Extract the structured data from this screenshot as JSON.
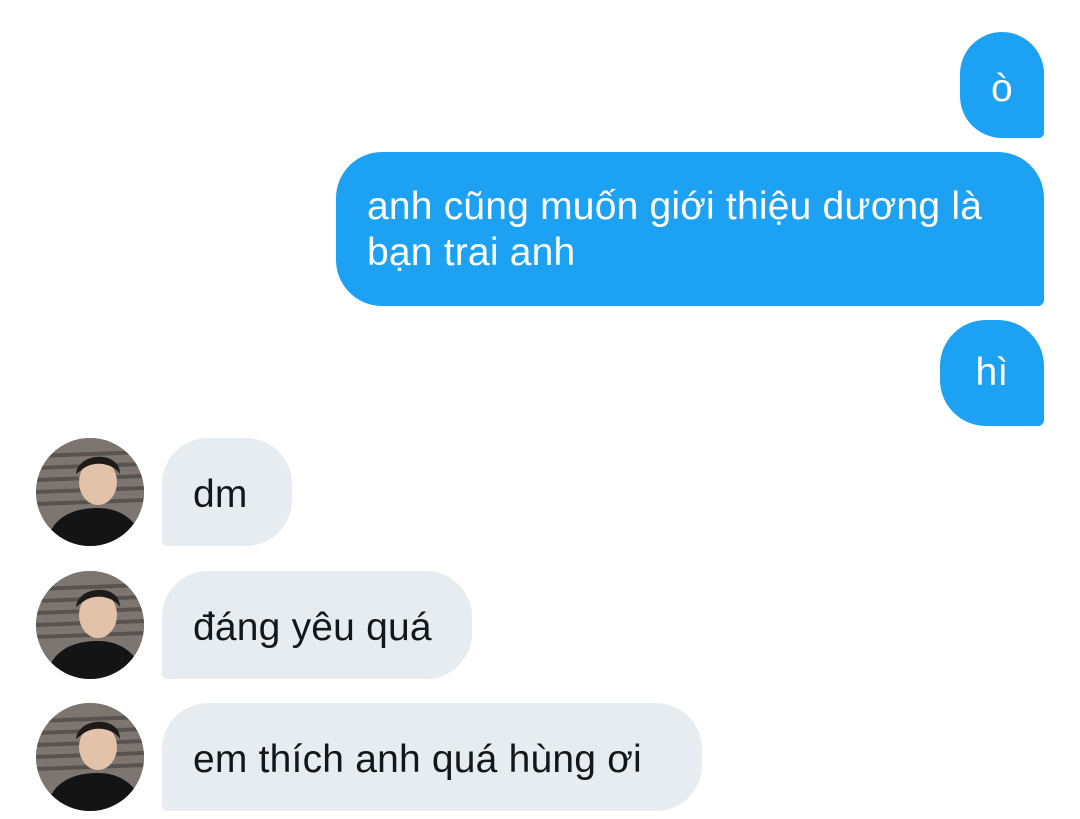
{
  "conversation": {
    "colors": {
      "outgoing_bubble": "#1da1f2",
      "outgoing_text": "#ffffff",
      "incoming_bubble": "#e6ecf0",
      "incoming_text": "#14171a"
    },
    "messages": [
      {
        "direction": "outgoing",
        "text": "ò"
      },
      {
        "direction": "outgoing",
        "text": "anh cũng muốn giới thiệu dương là bạn trai anh"
      },
      {
        "direction": "outgoing",
        "text": "hì"
      },
      {
        "direction": "incoming",
        "text": "dm",
        "avatar": "avatar-photo-icon"
      },
      {
        "direction": "incoming",
        "text": "đáng yêu quá",
        "avatar": "avatar-photo-icon"
      },
      {
        "direction": "incoming",
        "text": "em thích anh quá hùng ơi",
        "avatar": "avatar-photo-icon"
      }
    ]
  }
}
